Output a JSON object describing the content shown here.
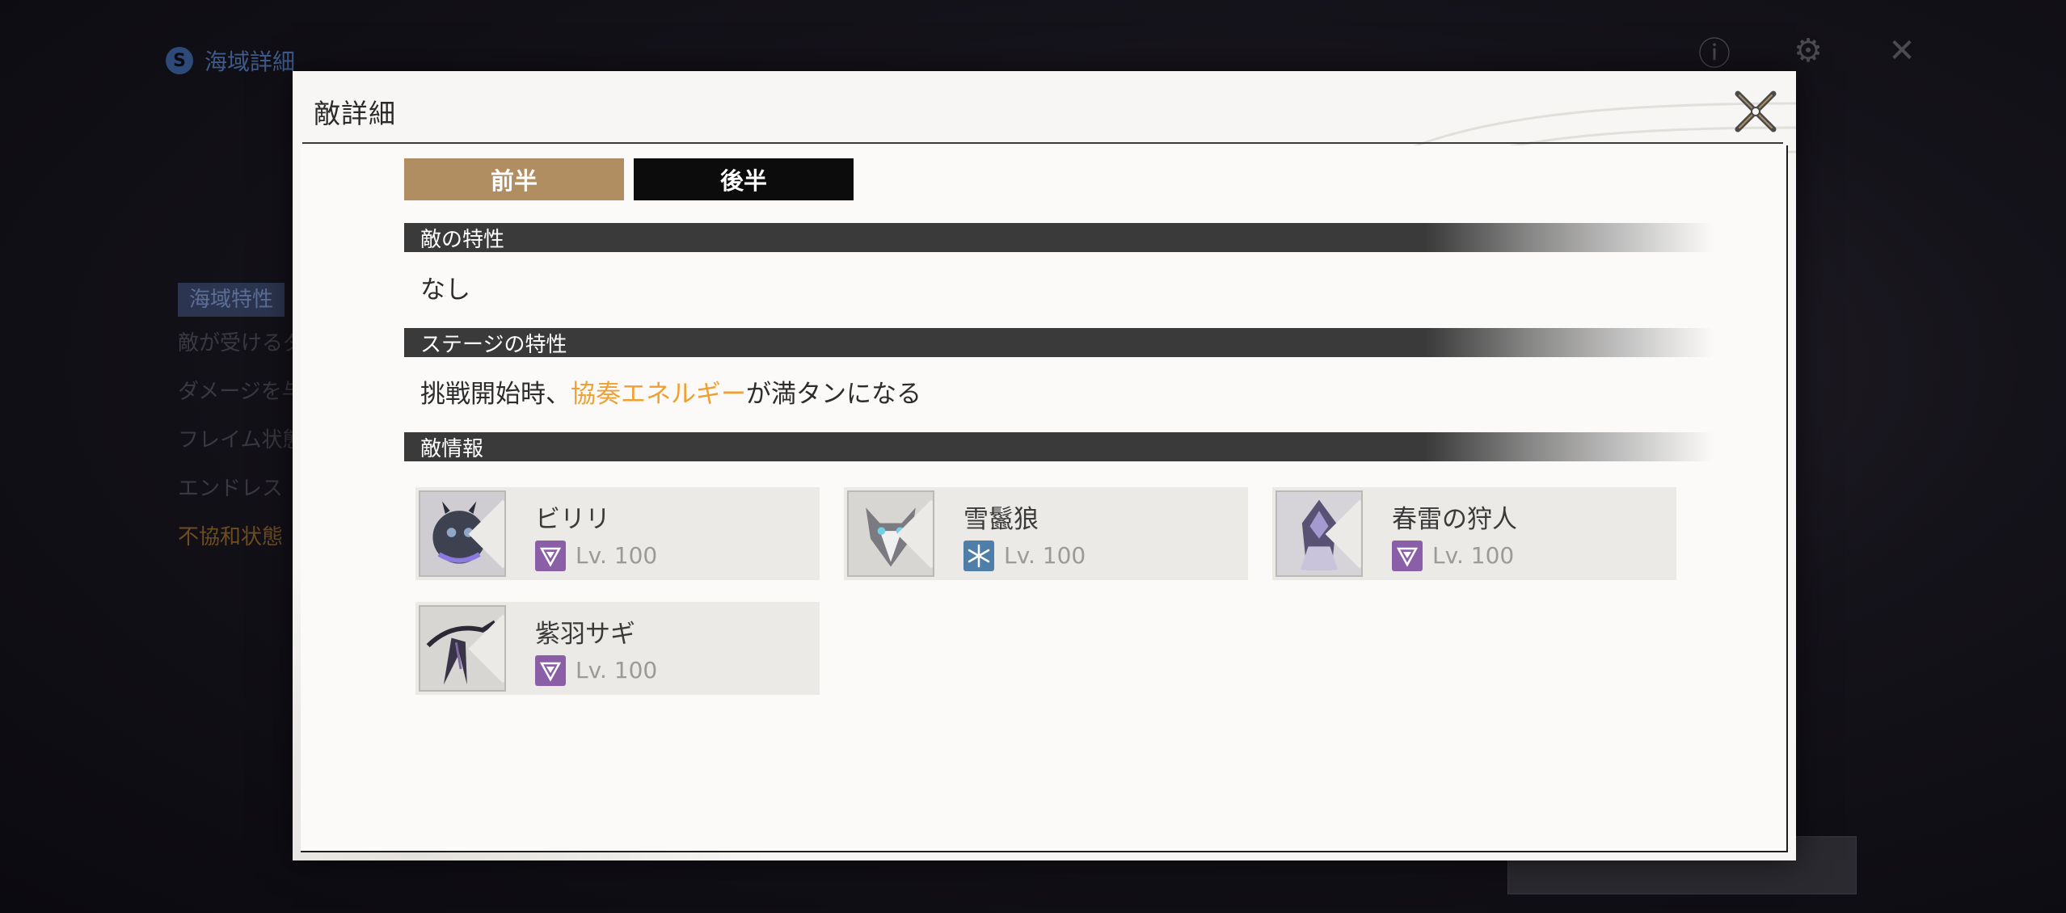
{
  "background": {
    "title": "海域詳細",
    "panel_chip": "海域特性",
    "panel_lines": [
      "敵が受けるダメージ",
      "ダメージを与えると",
      "フレイム状態に入る",
      "エンドレス",
      "不協和状態"
    ]
  },
  "modal": {
    "title": "敵詳細",
    "tabs": [
      {
        "label": "前半",
        "active": true
      },
      {
        "label": "後半",
        "active": false
      }
    ],
    "sections": {
      "enemy_traits": {
        "heading": "敵の特性",
        "text": "なし"
      },
      "stage_traits": {
        "heading": "ステージの特性",
        "text_before": "挑戦開始時、",
        "text_highlight": "協奏エネルギー",
        "text_after": "が満タンになる"
      },
      "enemy_info": {
        "heading": "敵情報"
      }
    },
    "enemies": [
      {
        "name": "ビリリ",
        "level": "Lv. 100",
        "element": "electro-icon"
      },
      {
        "name": "雪鬣狼",
        "level": "Lv. 100",
        "element": "glacio-icon"
      },
      {
        "name": "春雷の狩人",
        "level": "Lv. 100",
        "element": "electro-icon"
      },
      {
        "name": "紫羽サギ",
        "level": "Lv. 100",
        "element": "electro-icon"
      }
    ]
  },
  "colors": {
    "accent_tab": "#b08e62",
    "highlight": "#f0a030",
    "electro": "#8a5fa8",
    "glacio": "#4f7fa8"
  }
}
